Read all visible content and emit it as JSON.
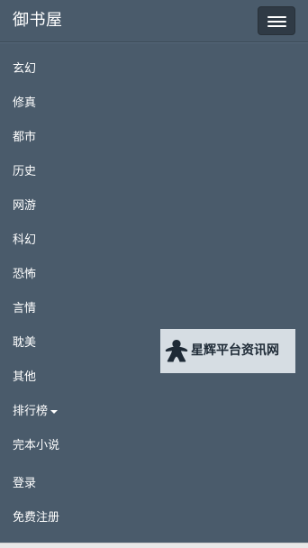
{
  "brand": "御书屋",
  "menu_button_icon": "hamburger-icon",
  "nav": {
    "items": [
      {
        "label": "玄幻"
      },
      {
        "label": "修真"
      },
      {
        "label": "都市"
      },
      {
        "label": "历史"
      },
      {
        "label": "网游"
      },
      {
        "label": "科幻"
      },
      {
        "label": "恐怖"
      },
      {
        "label": "言情"
      },
      {
        "label": "耽美"
      },
      {
        "label": "其他"
      },
      {
        "label": "排行榜"
      },
      {
        "label": "完本小说"
      }
    ],
    "account": [
      {
        "label": "登录"
      },
      {
        "label": "免费注册"
      }
    ]
  },
  "watermark": {
    "text": "星辉平台资讯网",
    "icon": "meeple-icon"
  },
  "colors": {
    "navbar_bg": "#4a5b6b",
    "toggle_bg": "#2f3a45",
    "text": "#ffffff"
  }
}
